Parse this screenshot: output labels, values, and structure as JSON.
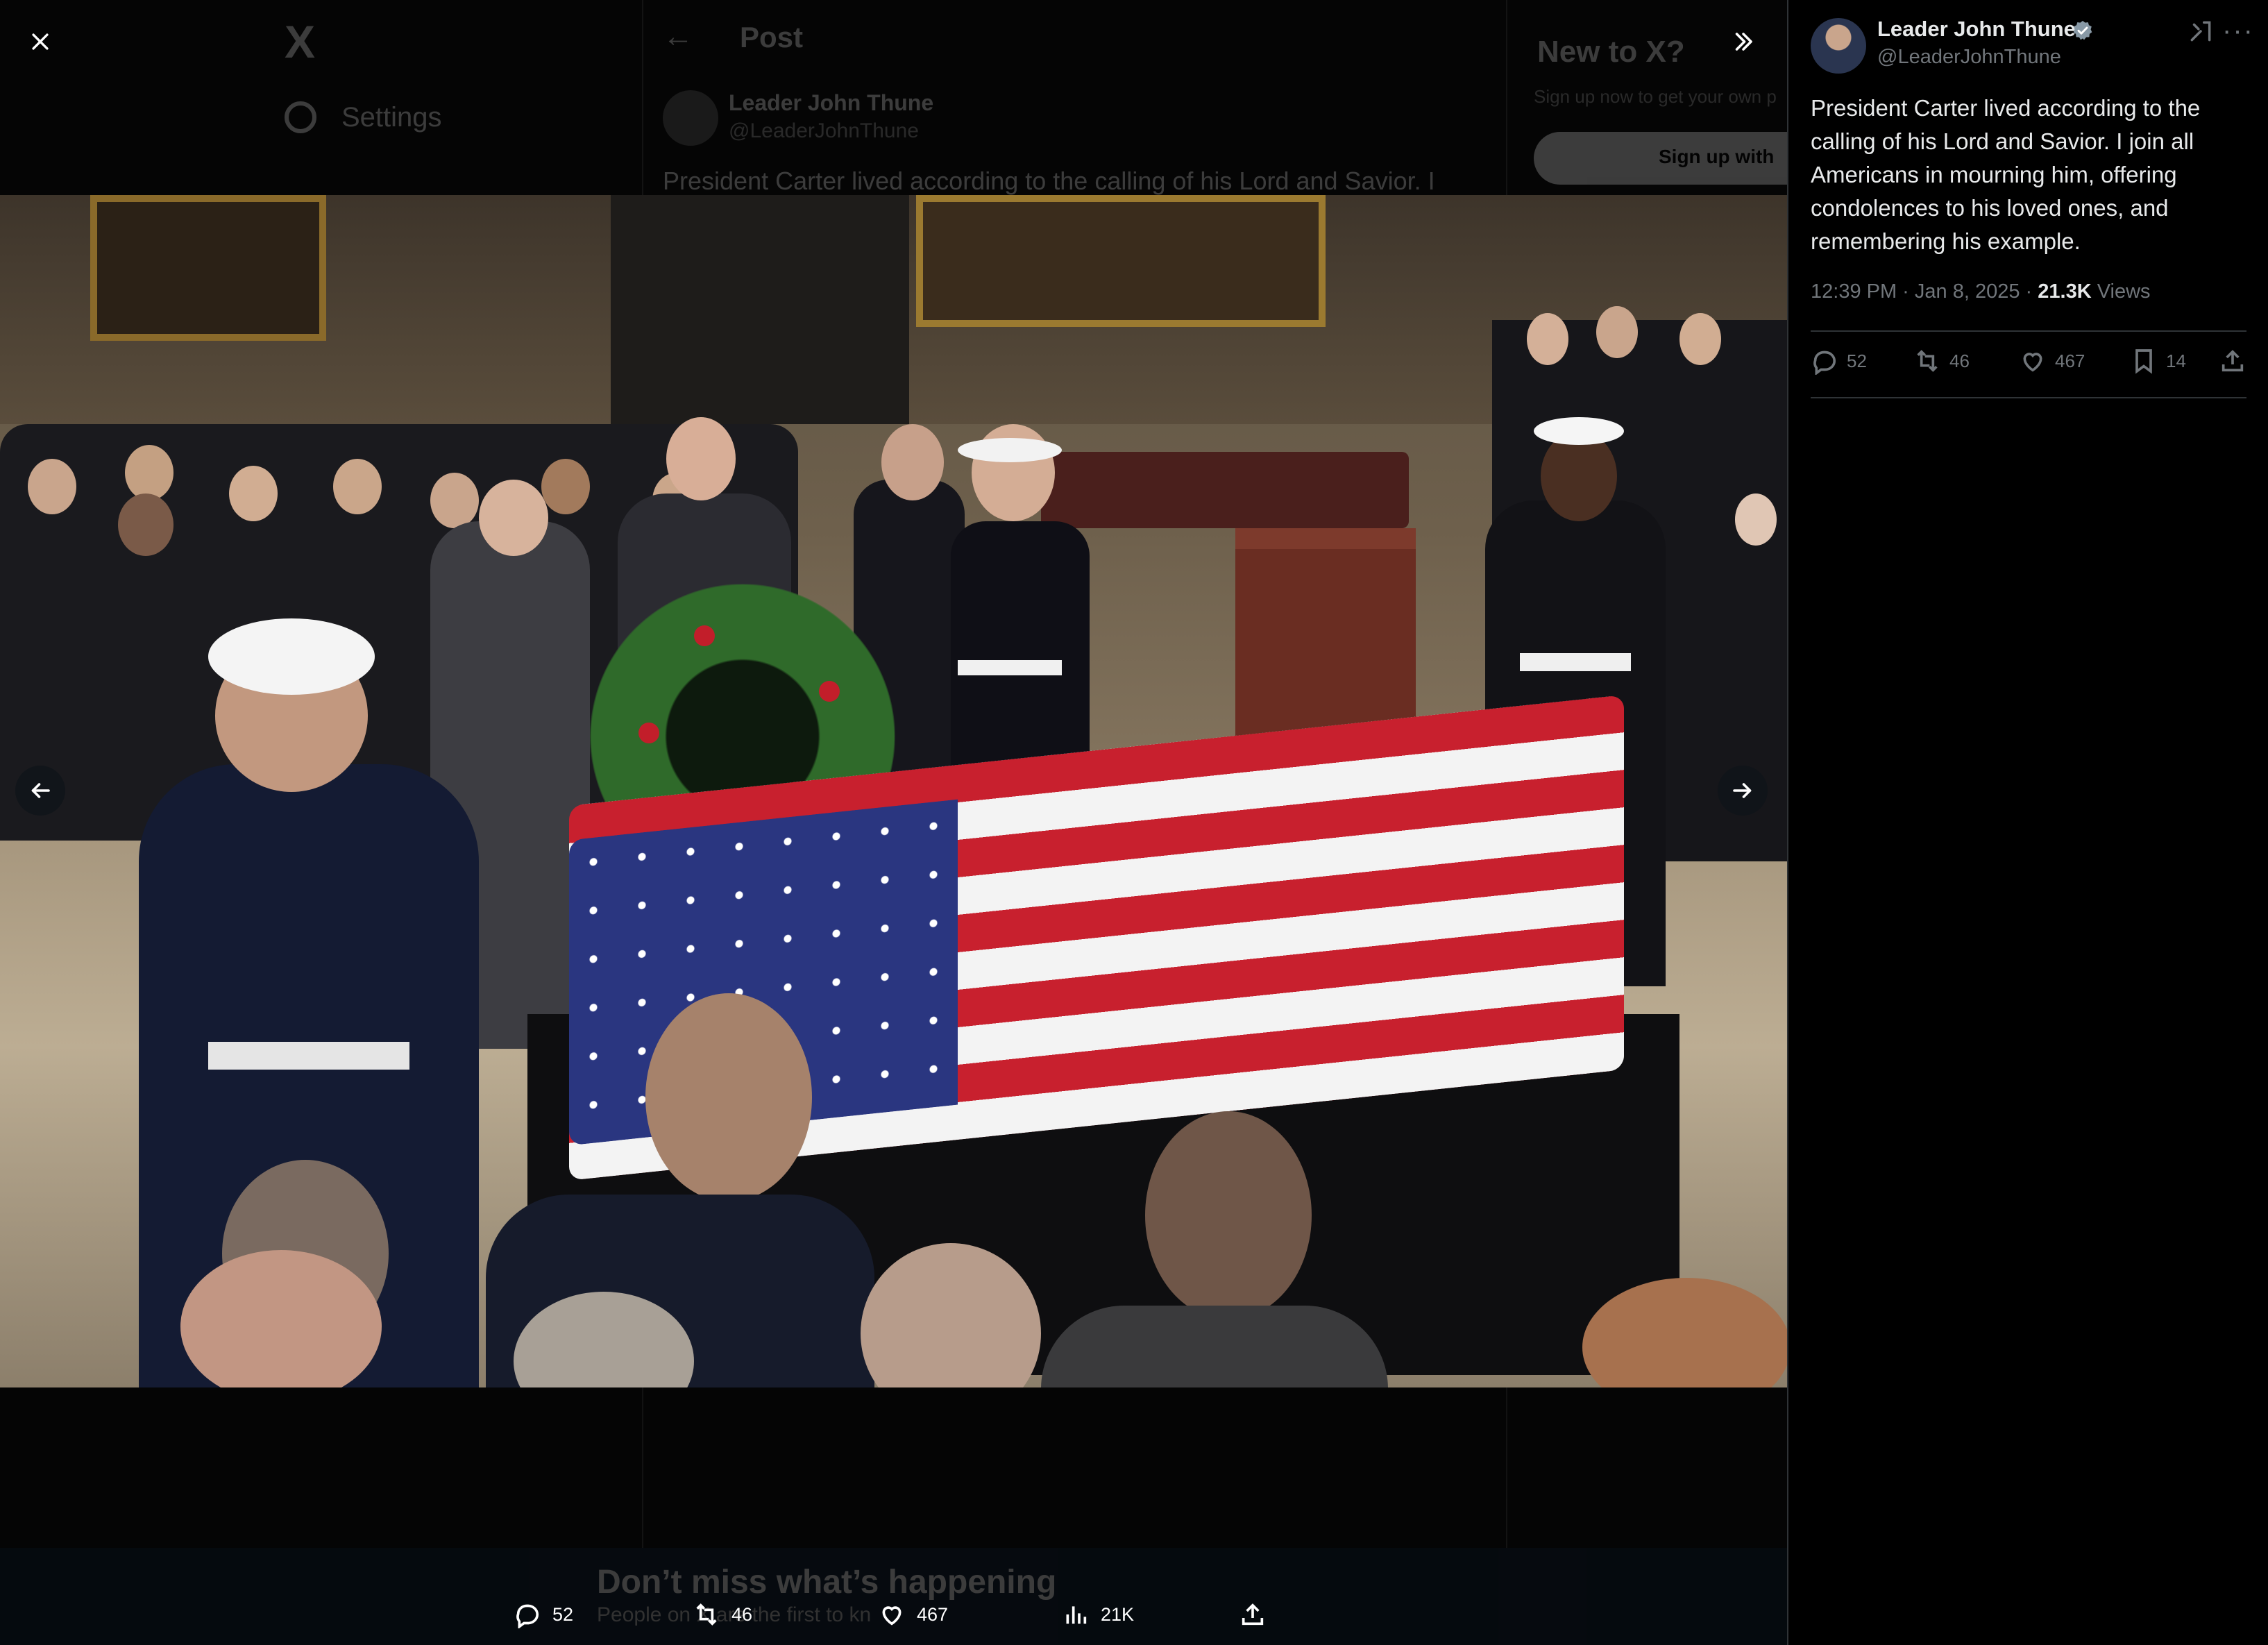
{
  "background_page": {
    "logo": "X",
    "settings_label": "Settings",
    "header_title": "Post",
    "author_name": "Leader John Thune",
    "author_handle": "@LeaderJohnThune",
    "tweet_preview": "President Carter lived according to the calling of his Lord and Savior. I",
    "new_to_x_title": "New to X?",
    "new_to_x_text": "Sign up now to get your own p",
    "signup_button": "Sign up with",
    "banner_title": "Don’t miss what’s happening",
    "banner_subtitle": "People on X are the first to kn"
  },
  "viewer": {
    "close_icon": "close-icon",
    "expand_icon": "chevron-double-right-icon",
    "prev_icon": "arrow-left-icon",
    "next_icon": "arrow-right-icon",
    "photo_alt": "Flag-draped casket in the Capitol Rotunda with honor guard and attendees",
    "actions": {
      "replies": "52",
      "reposts": "46",
      "likes": "467",
      "views": "21K"
    }
  },
  "panel": {
    "author_name": "Leader John Thune",
    "author_handle": "@LeaderJohnThune",
    "tweet_text": "President Carter lived according to the calling of his Lord and Savior. I join all Americans in mourning him, offering condolences to his loved ones, and remembering his example.",
    "time": "12:39 PM · Jan 8, 2025 · ",
    "views_count": "21.3K",
    "views_label": " Views",
    "actions": {
      "replies": "52",
      "reposts": "46",
      "likes": "467",
      "bookmarks": "14"
    }
  },
  "colors": {
    "background": "#000000",
    "text_primary": "#e7e9ea",
    "text_secondary": "#71767b",
    "verified_blue": "#1d9bf0",
    "border": "#2f3336"
  }
}
